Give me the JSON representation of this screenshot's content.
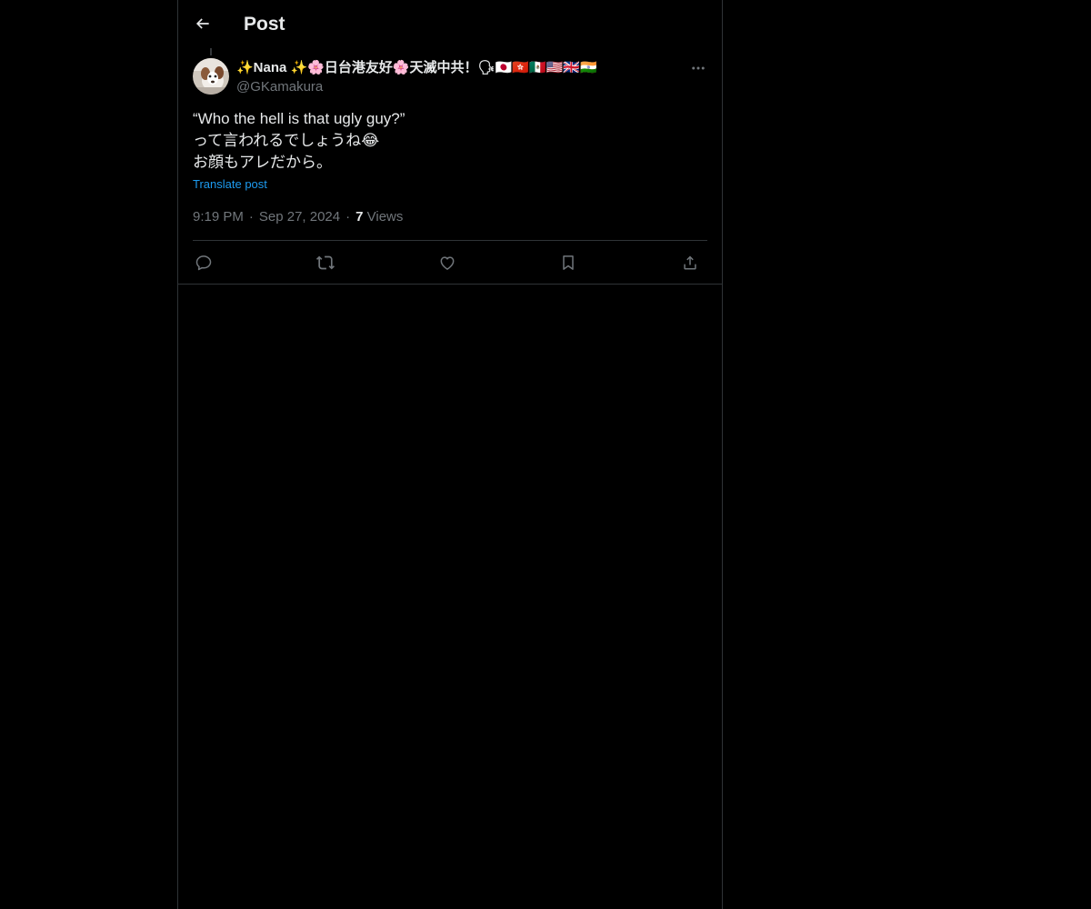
{
  "header": {
    "title": "Post"
  },
  "author": {
    "display_name": "✨Nana ✨🌸日台港友好🌸天滅中共！🗣🇯🇵🇭🇰🇲🇽🇺🇸🇬🇧🇮🇳",
    "handle": "@GKamakura"
  },
  "post": {
    "lines": [
      "“Who the hell is that ugly guy?”",
      "って言われるでしょうね😂",
      "お顔もアレだから。"
    ],
    "translate_label": "Translate post",
    "time": "9:19 PM",
    "date": "Sep 27, 2024",
    "views_count": "7",
    "views_label": "Views",
    "separator": "·"
  },
  "icons": {
    "back": "arrow-left-icon",
    "more": "more-horizontal-icon",
    "reply": "reply-icon",
    "repost": "repost-icon",
    "like": "heart-icon",
    "bookmark": "bookmark-icon",
    "share": "share-icon"
  },
  "colors": {
    "background": "#000000",
    "text_primary": "#e7e9ea",
    "text_secondary": "#71767b",
    "accent": "#1d9bf0",
    "border": "#2f3336"
  }
}
